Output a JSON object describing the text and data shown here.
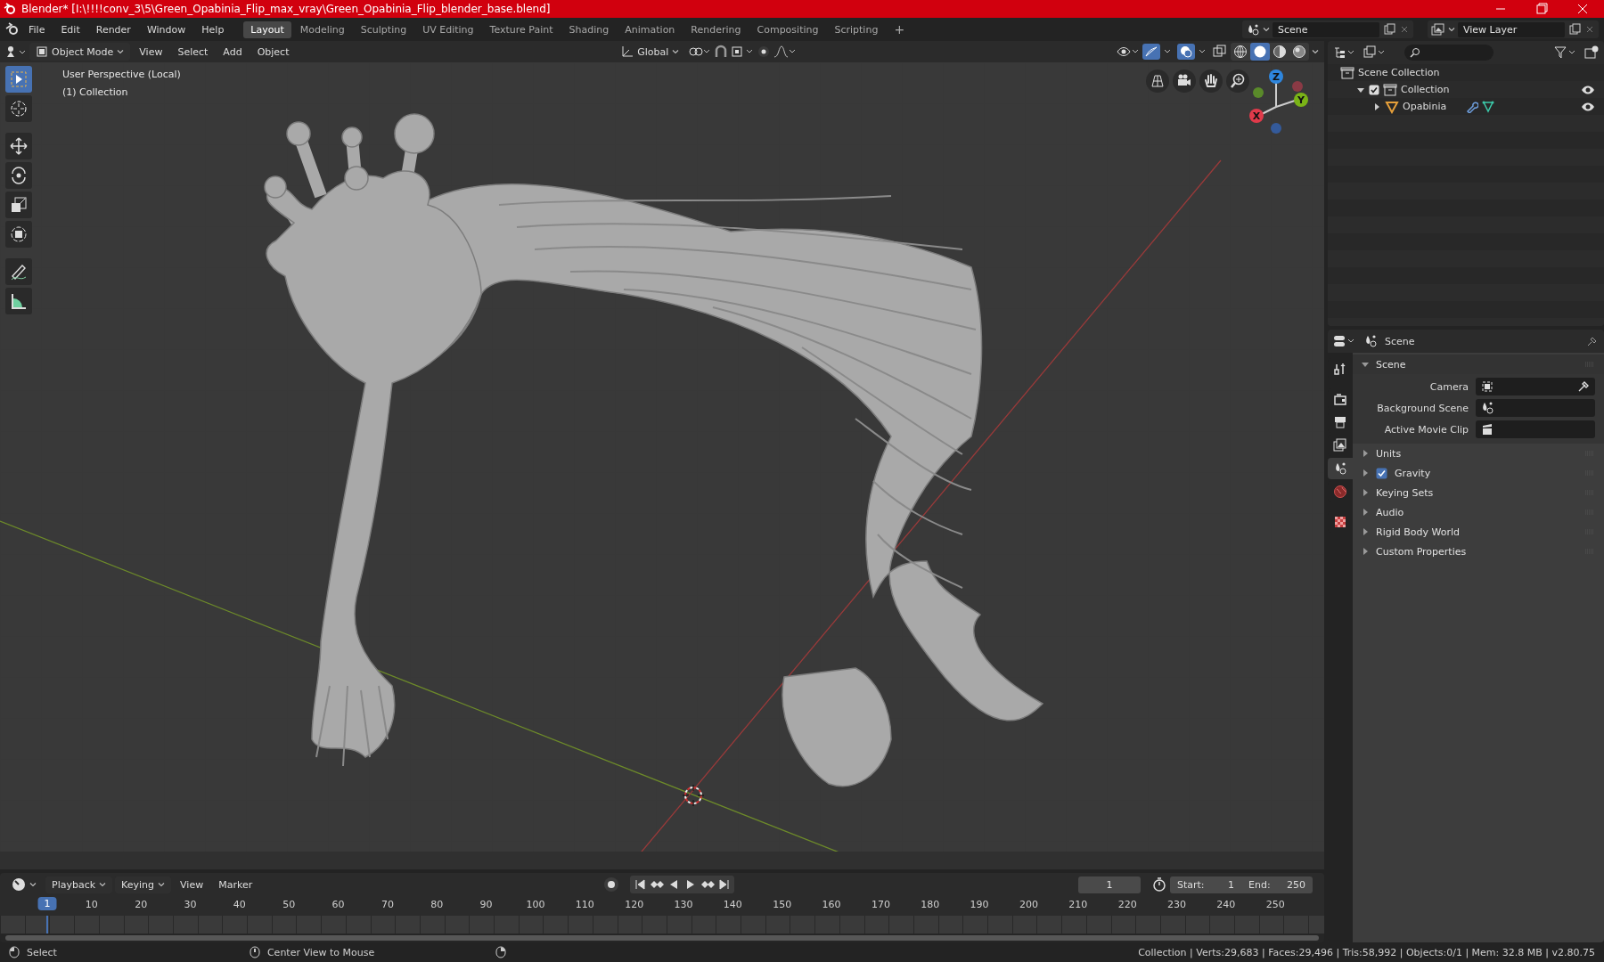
{
  "window": {
    "title": "Blender* [I:\\!!!!conv_3\\5\\Green_Opabinia_Flip_max_vray\\Green_Opabinia_Flip_blender_base.blend]"
  },
  "menu": [
    "File",
    "Edit",
    "Render",
    "Window",
    "Help"
  ],
  "workspaces": [
    {
      "label": "Layout",
      "selected": true
    },
    {
      "label": "Modeling",
      "selected": false
    },
    {
      "label": "Sculpting",
      "selected": false
    },
    {
      "label": "UV Editing",
      "selected": false
    },
    {
      "label": "Texture Paint",
      "selected": false
    },
    {
      "label": "Shading",
      "selected": false
    },
    {
      "label": "Animation",
      "selected": false
    },
    {
      "label": "Rendering",
      "selected": false
    },
    {
      "label": "Compositing",
      "selected": false
    },
    {
      "label": "Scripting",
      "selected": false
    }
  ],
  "add_workspace": "+",
  "scene_selector": {
    "value": "Scene"
  },
  "view_layer_selector": {
    "value": "View Layer"
  },
  "viewport_header": {
    "mode": "Object Mode",
    "menus": [
      "View",
      "Select",
      "Add",
      "Object"
    ],
    "orientation": "Global",
    "shading": [
      {
        "kind": "wireframe",
        "selected": false
      },
      {
        "kind": "solid",
        "selected": true
      },
      {
        "kind": "material",
        "selected": false
      },
      {
        "kind": "rendered",
        "selected": false
      }
    ]
  },
  "viewport": {
    "overlay_lines": [
      "User Perspective (Local)",
      "(1) Collection"
    ],
    "tools": [
      {
        "kind": "select",
        "selected": true
      },
      {
        "kind": "cursor",
        "selected": false
      },
      {
        "kind": "move",
        "selected": false
      },
      {
        "kind": "rotate",
        "selected": false
      },
      {
        "kind": "scale",
        "selected": false
      },
      {
        "kind": "transform",
        "selected": false
      },
      {
        "kind": "annotate",
        "selected": false
      },
      {
        "kind": "measure",
        "selected": false
      }
    ],
    "gizmo": {
      "x": "X",
      "y": "Y",
      "z": "Z"
    }
  },
  "outliner": {
    "items": [
      {
        "label": "Scene Collection",
        "children": [
          {
            "label": "Collection",
            "expanded": true,
            "checked": true,
            "children": [
              {
                "label": "Opabinia",
                "expanded": false
              }
            ]
          }
        ]
      }
    ]
  },
  "properties": {
    "context": "Scene",
    "tabs": [
      {
        "kind": "tool",
        "selected": false
      },
      {
        "kind": "render",
        "selected": false
      },
      {
        "kind": "output",
        "selected": false
      },
      {
        "kind": "view_layer",
        "selected": false
      },
      {
        "kind": "scene",
        "selected": true
      },
      {
        "kind": "world",
        "selected": false
      },
      {
        "kind": "texture",
        "selected": false
      }
    ],
    "panels": [
      {
        "label": "Scene",
        "expanded": true,
        "fields": [
          {
            "label": "Camera",
            "kind": "object"
          },
          {
            "label": "Background Scene",
            "kind": "scene"
          },
          {
            "label": "Active Movie Clip",
            "kind": "clip"
          }
        ]
      },
      {
        "label": "Units",
        "expanded": false
      },
      {
        "label": "Gravity",
        "expanded": false,
        "checked": true
      },
      {
        "label": "Keying Sets",
        "expanded": false
      },
      {
        "label": "Audio",
        "expanded": false
      },
      {
        "label": "Rigid Body World",
        "expanded": false
      },
      {
        "label": "Custom Properties",
        "expanded": false
      }
    ]
  },
  "timeline": {
    "menus": [
      "Playback",
      "Keying",
      "View",
      "Marker"
    ],
    "current_frame": "1",
    "start_label": "Start:",
    "start": "1",
    "end_label": "End:",
    "end": "250",
    "playhead": "1",
    "ticks": [
      "10",
      "20",
      "30",
      "40",
      "50",
      "60",
      "70",
      "80",
      "90",
      "100",
      "110",
      "120",
      "130",
      "140",
      "150",
      "160",
      "170",
      "180",
      "190",
      "200",
      "210",
      "220",
      "230",
      "240",
      "250"
    ]
  },
  "status_bar": {
    "hints": [
      "Select",
      "Center View to Mouse"
    ],
    "stats": "Collection | Verts:29,683 | Faces:29,496 | Tris:58,992 | Objects:0/1 | Mem: 32.8 MB | v2.80.75"
  }
}
